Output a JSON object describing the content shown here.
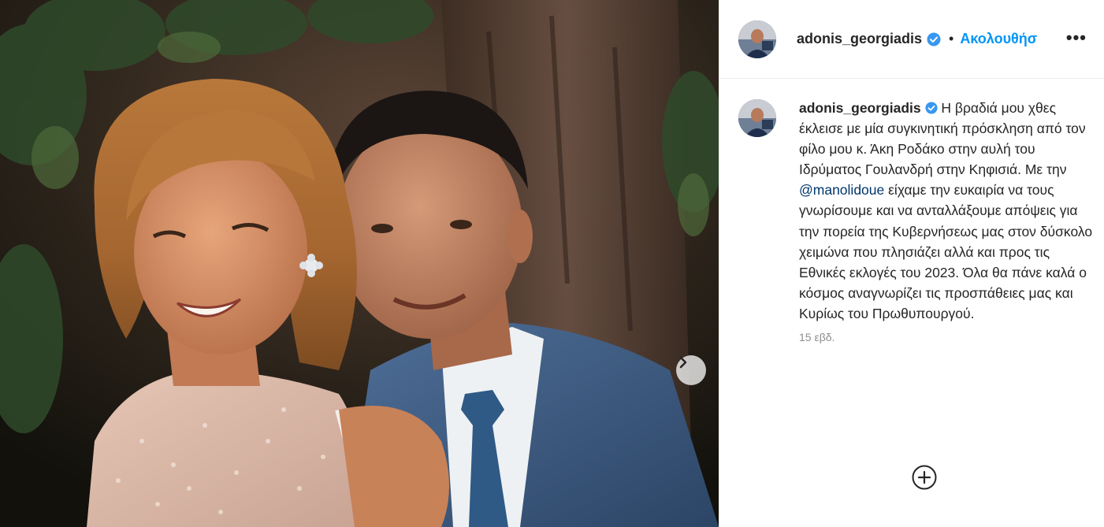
{
  "post": {
    "username": "adonis_georgiadis",
    "separator": "•",
    "follow_label": "Ακολουθήσ",
    "more_label": "•••",
    "caption": {
      "username": "adonis_georgiadis",
      "text_before_mention": "Η βραδιά μου χθες έκλεισε με μία συγκινητική πρόσκληση από τον φίλο μου κ. Άκη Ροδάκο στην αυλή του Ιδρύματος Γουλανδρή στην Κηφισιά. Με την",
      "mention": "@manolidoue",
      "text_after_mention": "είχαμε την ευκαιρία να τους γνωρίσουμε και να ανταλλάξουμε απόψεις για την πορεία της Κυβερνήσεως μας στον δύσκολο χειμώνα που πλησιάζει αλλά και προς τις Εθνικές εκλογές του 2023. Όλα θα πάνε καλά ο κόσμος αναγνωρίζει τις προσπάθειες μας και Κυρίως του Πρωθυπουργού."
    },
    "timestamp": "15 εβδ."
  },
  "icons": {
    "verified": "verified-badge-icon",
    "next": "chevron-right-icon",
    "add_comment": "plus-circle-icon",
    "more": "more-options-icon"
  },
  "colors": {
    "link_blue": "#0095f6",
    "mention_blue": "#00376b",
    "verified_blue": "#3897f0",
    "muted": "#8e8e8e"
  }
}
